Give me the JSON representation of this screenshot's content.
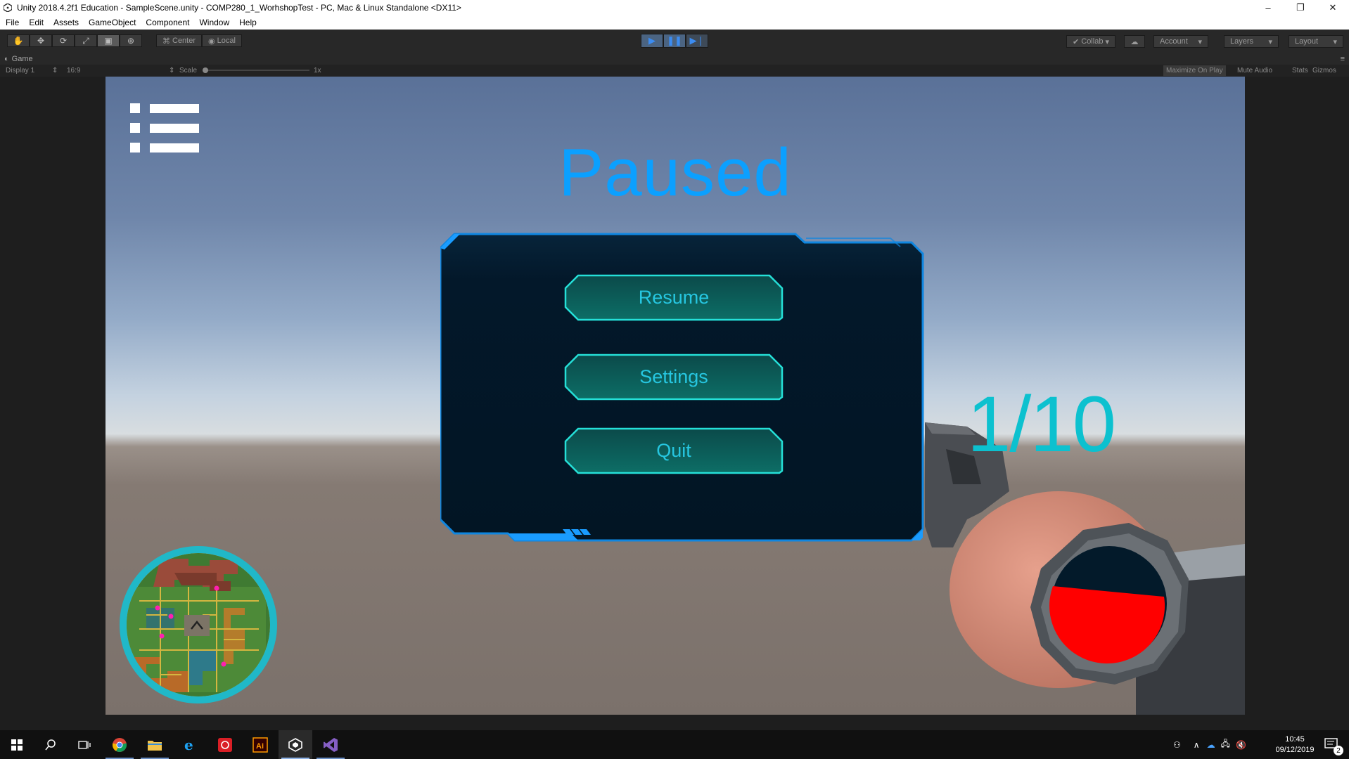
{
  "window": {
    "title": "Unity 2018.4.2f1 Education - SampleScene.unity - COMP280_1_WorhshopTest - PC, Mac & Linux Standalone <DX11>",
    "controls": {
      "minimize": "–",
      "restore": "❐",
      "close": "✕"
    }
  },
  "menu": [
    "File",
    "Edit",
    "Assets",
    "GameObject",
    "Component",
    "Window",
    "Help"
  ],
  "toolbar": {
    "pivot_mode": "Center",
    "pivot_rotation": "Local",
    "collab": "Collab",
    "account": "Account",
    "layers": "Layers",
    "layout": "Layout",
    "play_state": "playing"
  },
  "game_view": {
    "tab_label": "Game",
    "display": "Display 1",
    "aspect": "16:9",
    "scale_label": "Scale",
    "scale_value": "1x",
    "maximize_on_play": "Maximize On Play",
    "mute_audio": "Mute Audio",
    "stats": "Stats",
    "gizmos": "Gizmos"
  },
  "game": {
    "paused_title": "Paused",
    "buttons": {
      "resume": "Resume",
      "settings": "Settings",
      "quit": "Quit"
    },
    "ammo": "1/10",
    "accent_color": "#0ba0ff",
    "button_text_color": "#26c6e0"
  },
  "taskbar": {
    "apps": [
      "windows-start",
      "search",
      "task-view",
      "chrome",
      "file-explorer",
      "internet-explorer",
      "creative-cloud",
      "illustrator",
      "unity",
      "visual-studio"
    ],
    "time": "10:45",
    "date": "09/12/2019",
    "notification_count": "2"
  }
}
